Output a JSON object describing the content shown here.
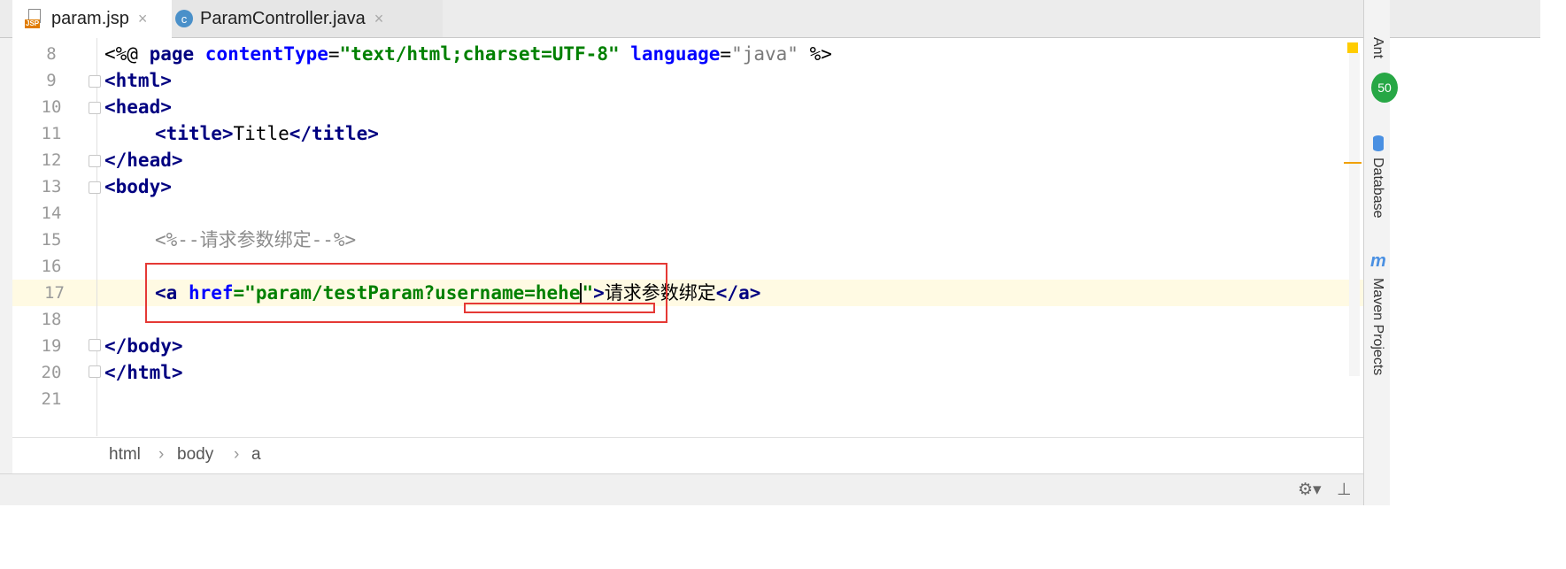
{
  "tabs": [
    {
      "label": "param.jsp",
      "close": "×",
      "icon": "jsp-file-icon",
      "badge": "JSP"
    },
    {
      "label": "ParamController.java",
      "close": "×",
      "icon": "java-class-icon",
      "badge": "c"
    }
  ],
  "editor": {
    "lines": [
      8,
      9,
      10,
      11,
      12,
      13,
      14,
      15,
      16,
      17,
      18,
      19,
      20,
      21
    ],
    "code": {
      "l8": {
        "p1": "<%@ ",
        "p2": "page ",
        "p3": "contentType",
        "p4": "=",
        "p5": "\"text/html;charset=UTF-8\"",
        "p6": " language",
        "p7": "=",
        "p8": "\"java\"",
        "p9": " %>"
      },
      "l9": "<html>",
      "l10": "<head>",
      "l11": {
        "open": "<title>",
        "text": "Title",
        "close": "</title>"
      },
      "l12": "</head>",
      "l13": "<body>",
      "l15": "<%--请求参数绑定--%>",
      "l17": {
        "open": "<a ",
        "attr": "href",
        "eq": "=",
        "val_before_caret": "\"param/testParam?username=hehe",
        "val_after_caret": "\"",
        "gt": ">",
        "text": "请求参数绑定",
        "close": "</a>"
      },
      "l19": "</body>",
      "l20": "</html>"
    }
  },
  "breadcrumb": {
    "items": [
      "html",
      "body",
      "a"
    ],
    "sep": "›"
  },
  "status": {
    "gear": "⚙▾",
    "pin": "⊥"
  },
  "right_panel": {
    "ant": "Ant",
    "badge": "50",
    "database": "Database",
    "maven_icon": "m",
    "maven": "Maven Projects"
  }
}
